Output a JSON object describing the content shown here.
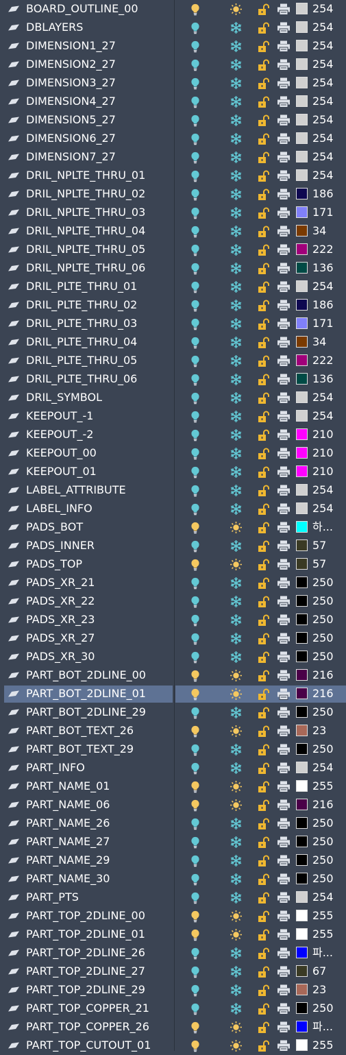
{
  "layers": [
    {
      "name": "BOARD_OUTLINE_00",
      "on": true,
      "frozen": false,
      "color": "#d0d0d0",
      "color_label": "254"
    },
    {
      "name": "DBLAYERS",
      "on": false,
      "frozen": true,
      "color": "#d0d0d0",
      "color_label": "254"
    },
    {
      "name": "DIMENSION1_27",
      "on": false,
      "frozen": true,
      "color": "#d0d0d0",
      "color_label": "254"
    },
    {
      "name": "DIMENSION2_27",
      "on": false,
      "frozen": true,
      "color": "#d0d0d0",
      "color_label": "254"
    },
    {
      "name": "DIMENSION3_27",
      "on": false,
      "frozen": true,
      "color": "#d0d0d0",
      "color_label": "254"
    },
    {
      "name": "DIMENSION4_27",
      "on": false,
      "frozen": true,
      "color": "#d0d0d0",
      "color_label": "254"
    },
    {
      "name": "DIMENSION5_27",
      "on": false,
      "frozen": true,
      "color": "#d0d0d0",
      "color_label": "254"
    },
    {
      "name": "DIMENSION6_27",
      "on": false,
      "frozen": true,
      "color": "#d0d0d0",
      "color_label": "254"
    },
    {
      "name": "DIMENSION7_27",
      "on": false,
      "frozen": true,
      "color": "#d0d0d0",
      "color_label": "254"
    },
    {
      "name": "DRIL_NPLTE_THRU_01",
      "on": false,
      "frozen": true,
      "color": "#d0d0d0",
      "color_label": "254"
    },
    {
      "name": "DRIL_NPLTE_THRU_02",
      "on": false,
      "frozen": true,
      "color": "#0e0850",
      "color_label": "186"
    },
    {
      "name": "DRIL_NPLTE_THRU_03",
      "on": false,
      "frozen": true,
      "color": "#8080f8",
      "color_label": "171"
    },
    {
      "name": "DRIL_NPLTE_THRU_04",
      "on": false,
      "frozen": true,
      "color": "#7a3a00",
      "color_label": "34"
    },
    {
      "name": "DRIL_NPLTE_THRU_05",
      "on": false,
      "frozen": true,
      "color": "#a0007a",
      "color_label": "222"
    },
    {
      "name": "DRIL_NPLTE_THRU_06",
      "on": false,
      "frozen": true,
      "color": "#004a45",
      "color_label": "136"
    },
    {
      "name": "DRIL_PLTE_THRU_01",
      "on": false,
      "frozen": true,
      "color": "#d0d0d0",
      "color_label": "254"
    },
    {
      "name": "DRIL_PLTE_THRU_02",
      "on": false,
      "frozen": true,
      "color": "#0e0850",
      "color_label": "186"
    },
    {
      "name": "DRIL_PLTE_THRU_03",
      "on": false,
      "frozen": true,
      "color": "#8080f8",
      "color_label": "171"
    },
    {
      "name": "DRIL_PLTE_THRU_04",
      "on": false,
      "frozen": true,
      "color": "#7a3a00",
      "color_label": "34"
    },
    {
      "name": "DRIL_PLTE_THRU_05",
      "on": false,
      "frozen": true,
      "color": "#a0007a",
      "color_label": "222"
    },
    {
      "name": "DRIL_PLTE_THRU_06",
      "on": false,
      "frozen": true,
      "color": "#004a45",
      "color_label": "136"
    },
    {
      "name": "DRIL_SYMBOL",
      "on": false,
      "frozen": true,
      "color": "#d0d0d0",
      "color_label": "254"
    },
    {
      "name": "KEEPOUT_-1",
      "on": false,
      "frozen": true,
      "color": "#d0d0d0",
      "color_label": "254"
    },
    {
      "name": "KEEPOUT_-2",
      "on": false,
      "frozen": true,
      "color": "#ff00ff",
      "color_label": "210"
    },
    {
      "name": "KEEPOUT_00",
      "on": false,
      "frozen": true,
      "color": "#ff00ff",
      "color_label": "210"
    },
    {
      "name": "KEEPOUT_01",
      "on": false,
      "frozen": true,
      "color": "#ff00ff",
      "color_label": "210"
    },
    {
      "name": "LABEL_ATTRIBUTE",
      "on": false,
      "frozen": true,
      "color": "#d0d0d0",
      "color_label": "254"
    },
    {
      "name": "LABEL_INFO",
      "on": false,
      "frozen": true,
      "color": "#d0d0d0",
      "color_label": "254"
    },
    {
      "name": "PADS_BOT",
      "on": true,
      "frozen": false,
      "color": "#00ffff",
      "color_label": "하..."
    },
    {
      "name": "PADS_INNER",
      "on": false,
      "frozen": true,
      "color": "#3a3a24",
      "color_label": "57"
    },
    {
      "name": "PADS_TOP",
      "on": true,
      "frozen": false,
      "color": "#3a3a24",
      "color_label": "57"
    },
    {
      "name": "PADS_XR_21",
      "on": false,
      "frozen": true,
      "color": "#000000",
      "color_label": "250"
    },
    {
      "name": "PADS_XR_22",
      "on": false,
      "frozen": true,
      "color": "#000000",
      "color_label": "250"
    },
    {
      "name": "PADS_XR_23",
      "on": false,
      "frozen": true,
      "color": "#000000",
      "color_label": "250"
    },
    {
      "name": "PADS_XR_27",
      "on": false,
      "frozen": true,
      "color": "#000000",
      "color_label": "250"
    },
    {
      "name": "PADS_XR_30",
      "on": false,
      "frozen": true,
      "color": "#000000",
      "color_label": "250"
    },
    {
      "name": "PART_BOT_2DLINE_00",
      "on": true,
      "frozen": false,
      "color": "#4a0048",
      "color_label": "216"
    },
    {
      "name": "PART_BOT_2DLINE_01",
      "on": true,
      "frozen": false,
      "color": "#4a0048",
      "color_label": "216",
      "selected": true
    },
    {
      "name": "PART_BOT_2DLINE_29",
      "on": false,
      "frozen": true,
      "color": "#000000",
      "color_label": "250"
    },
    {
      "name": "PART_BOT_TEXT_26",
      "on": true,
      "frozen": false,
      "color": "#a86858",
      "color_label": "23"
    },
    {
      "name": "PART_BOT_TEXT_29",
      "on": false,
      "frozen": true,
      "color": "#000000",
      "color_label": "250"
    },
    {
      "name": "PART_INFO",
      "on": false,
      "frozen": true,
      "color": "#d0d0d0",
      "color_label": "254"
    },
    {
      "name": "PART_NAME_01",
      "on": true,
      "frozen": false,
      "color": "#ffffff",
      "color_label": "255"
    },
    {
      "name": "PART_NAME_06",
      "on": true,
      "frozen": false,
      "color": "#4a0048",
      "color_label": "216"
    },
    {
      "name": "PART_NAME_26",
      "on": false,
      "frozen": true,
      "color": "#000000",
      "color_label": "250"
    },
    {
      "name": "PART_NAME_27",
      "on": false,
      "frozen": true,
      "color": "#000000",
      "color_label": "250"
    },
    {
      "name": "PART_NAME_29",
      "on": false,
      "frozen": true,
      "color": "#000000",
      "color_label": "250"
    },
    {
      "name": "PART_NAME_30",
      "on": false,
      "frozen": true,
      "color": "#000000",
      "color_label": "250"
    },
    {
      "name": "PART_PTS",
      "on": false,
      "frozen": true,
      "color": "#d0d0d0",
      "color_label": "254"
    },
    {
      "name": "PART_TOP_2DLINE_00",
      "on": true,
      "frozen": false,
      "color": "#ffffff",
      "color_label": "255"
    },
    {
      "name": "PART_TOP_2DLINE_01",
      "on": true,
      "frozen": false,
      "color": "#ffffff",
      "color_label": "255"
    },
    {
      "name": "PART_TOP_2DLINE_26",
      "on": false,
      "frozen": true,
      "color": "#0000ff",
      "color_label": "파..."
    },
    {
      "name": "PART_TOP_2DLINE_27",
      "on": false,
      "frozen": true,
      "color": "#3a3a24",
      "color_label": "67"
    },
    {
      "name": "PART_TOP_2DLINE_29",
      "on": false,
      "frozen": true,
      "color": "#a86858",
      "color_label": "23"
    },
    {
      "name": "PART_TOP_COPPER_21",
      "on": false,
      "frozen": true,
      "color": "#000000",
      "color_label": "250"
    },
    {
      "name": "PART_TOP_COPPER_26",
      "on": true,
      "frozen": false,
      "color": "#0000ff",
      "color_label": "파..."
    },
    {
      "name": "PART_TOP_CUTOUT_01",
      "on": true,
      "frozen": false,
      "color": "#ffffff",
      "color_label": "255"
    }
  ],
  "icon_colors": {
    "status": "#dfe3ea",
    "on_bulb": "#f5c860",
    "off_bulb": "#63c9d5",
    "sun": "#f5c860",
    "snowflake": "#63c9d5",
    "lock": "#f0b830",
    "printer": "#dfe3ea"
  }
}
